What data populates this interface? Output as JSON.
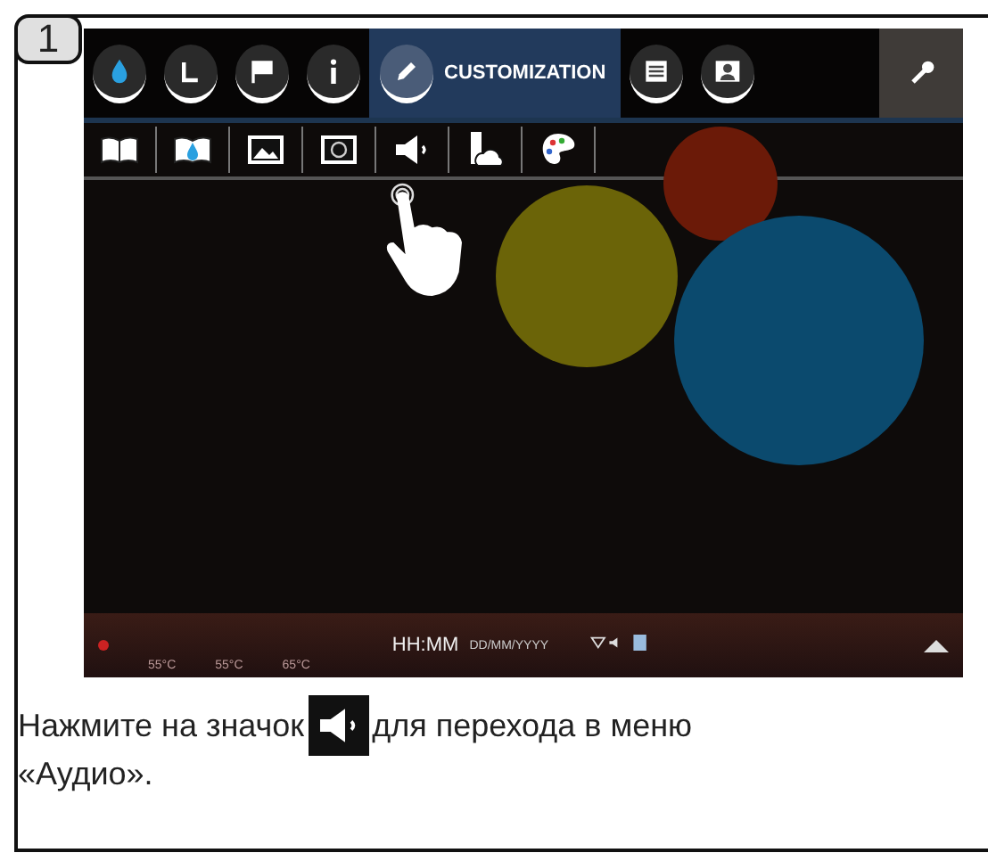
{
  "step_number": "1",
  "screen": {
    "top_tabs": [
      {
        "kind": "drop",
        "selected": false
      },
      {
        "kind": "clock",
        "selected": false
      },
      {
        "kind": "flag",
        "selected": false
      },
      {
        "kind": "info",
        "selected": false
      },
      {
        "kind": "pencil",
        "label": "CUSTOMIZATION",
        "selected": true
      },
      {
        "kind": "list",
        "selected": false
      },
      {
        "kind": "person",
        "selected": false
      }
    ],
    "tool_button": {
      "kind": "wrench"
    },
    "sub_icons": [
      {
        "kind": "book"
      },
      {
        "kind": "book-drop"
      },
      {
        "kind": "picture"
      },
      {
        "kind": "screensaver"
      },
      {
        "kind": "speaker"
      },
      {
        "kind": "usb-cloud"
      },
      {
        "kind": "palette"
      }
    ],
    "highlights": [
      {
        "color": "#6b1a08"
      },
      {
        "color": "#6b6408"
      },
      {
        "color": "#0b4a6e"
      }
    ],
    "status_bar": {
      "temperatures": [
        "55°C",
        "55°C",
        "65°C"
      ],
      "time": "HH:MM",
      "date": "DD/MM/YYYY"
    }
  },
  "caption": {
    "before": "Нажмите на значок",
    "after": "для перехода в меню",
    "second_line": "«Аудио»."
  }
}
